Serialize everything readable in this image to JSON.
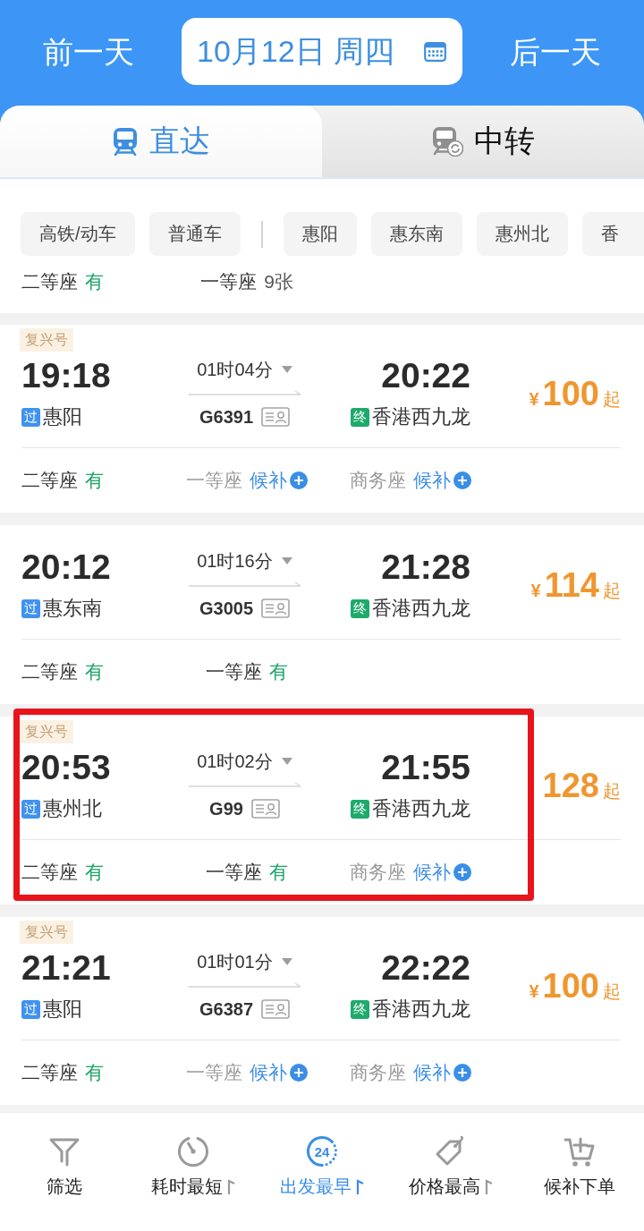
{
  "header": {
    "prev_day": "前一天",
    "date": "10月12日 周四",
    "next_day": "后一天"
  },
  "tabs": [
    {
      "label": "直达",
      "selected": true
    },
    {
      "label": "中转",
      "selected": false
    }
  ],
  "filters": {
    "train_types": [
      {
        "label": "高铁/动车",
        "selected": false
      },
      {
        "label": "普通车",
        "selected": false
      }
    ],
    "stations": [
      {
        "label": "惠阳",
        "selected": false
      },
      {
        "label": "惠东南",
        "selected": false
      },
      {
        "label": "惠州北",
        "selected": false
      },
      {
        "label": "香",
        "selected": false
      }
    ]
  },
  "previous_train_seats": [
    {
      "class": "二等座",
      "status": "有",
      "kind": "available"
    },
    {
      "class": "一等座",
      "status": "9张",
      "kind": "count"
    }
  ],
  "trains": [
    {
      "badge": "复兴号",
      "depart_time": "19:18",
      "depart_station": {
        "tag": "过",
        "color": "#3f93ee",
        "name": "惠阳"
      },
      "duration": "01时04分",
      "train_no": "G6391",
      "arrive_time": "20:22",
      "arrive_station": {
        "tag": "终",
        "color": "#1daa6b",
        "name": "香港西九龙"
      },
      "price": {
        "currency": "¥",
        "amount": "100",
        "suffix": "起"
      },
      "highlighted": false,
      "seats": [
        {
          "class": "二等座",
          "status": "有",
          "kind": "available"
        },
        {
          "class": "一等座",
          "status": "候补",
          "kind": "waitlist"
        },
        {
          "class": "商务座",
          "status": "候补",
          "kind": "waitlist"
        }
      ]
    },
    {
      "depart_time": "20:12",
      "depart_station": {
        "tag": "过",
        "color": "#3f93ee",
        "name": "惠东南"
      },
      "duration": "01时16分",
      "train_no": "G3005",
      "arrive_time": "21:28",
      "arrive_station": {
        "tag": "终",
        "color": "#1daa6b",
        "name": "香港西九龙"
      },
      "price": {
        "currency": "¥",
        "amount": "114",
        "suffix": "起"
      },
      "highlighted": false,
      "seats": [
        {
          "class": "二等座",
          "status": "有",
          "kind": "available"
        },
        {
          "class": "一等座",
          "status": "有",
          "kind": "available"
        }
      ]
    },
    {
      "badge": "复兴号",
      "depart_time": "20:53",
      "depart_station": {
        "tag": "过",
        "color": "#3f93ee",
        "name": "惠州北"
      },
      "duration": "01时02分",
      "train_no": "G99",
      "arrive_time": "21:55",
      "arrive_station": {
        "tag": "终",
        "color": "#1daa6b",
        "name": "香港西九龙"
      },
      "price": {
        "amount": "128",
        "suffix": "起"
      },
      "highlighted": true,
      "seats": [
        {
          "class": "二等座",
          "status": "有",
          "kind": "available"
        },
        {
          "class": "一等座",
          "status": "有",
          "kind": "available"
        },
        {
          "class": "商务座",
          "status": "候补",
          "kind": "waitlist"
        }
      ]
    },
    {
      "badge": "复兴号",
      "depart_time": "21:21",
      "depart_station": {
        "tag": "过",
        "color": "#3f93ee",
        "name": "惠阳"
      },
      "duration": "01时01分",
      "train_no": "G6387",
      "arrive_time": "22:22",
      "arrive_station": {
        "tag": "终",
        "color": "#1daa6b",
        "name": "香港西九龙"
      },
      "price": {
        "currency": "¥",
        "amount": "100",
        "suffix": "起"
      },
      "highlighted": false,
      "seats": [
        {
          "class": "二等座",
          "status": "有",
          "kind": "available"
        },
        {
          "class": "一等座",
          "status": "候补",
          "kind": "waitlist"
        },
        {
          "class": "商务座",
          "status": "候补",
          "kind": "waitlist"
        }
      ]
    }
  ],
  "bottom_nav": [
    {
      "label": "筛选",
      "selected": false,
      "sortable": false
    },
    {
      "label": "耗时最短",
      "selected": false,
      "sortable": true
    },
    {
      "label": "出发最早",
      "icon_text": "24",
      "selected": true,
      "sortable": true
    },
    {
      "label": "价格最高",
      "selected": false,
      "sortable": true
    },
    {
      "label": "候补下单",
      "selected": false,
      "sortable": false
    }
  ]
}
